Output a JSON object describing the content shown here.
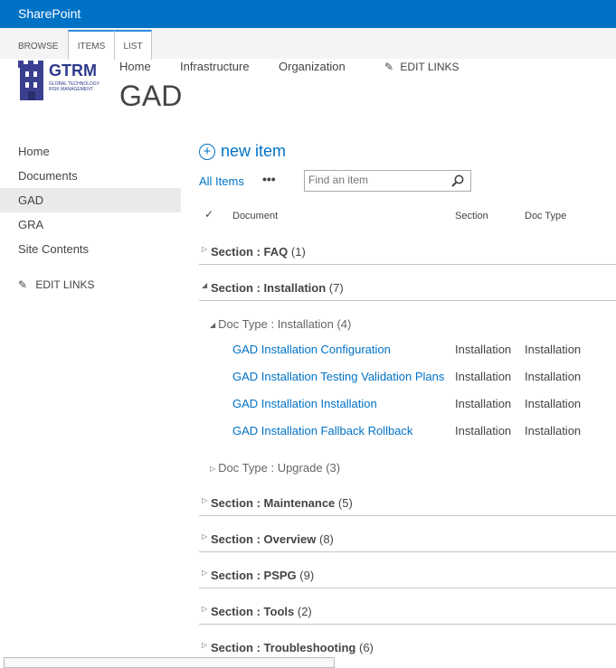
{
  "suite_bar": {
    "title": "SharePoint"
  },
  "ribbon": {
    "tabs": [
      "BROWSE",
      "ITEMS",
      "LIST"
    ]
  },
  "site": {
    "logo_text": "GTRM",
    "logo_tagline": "GLOBAL TECHNOLOGY RISK MANAGEMENT",
    "page_title": "GAD"
  },
  "top_nav": {
    "items": [
      "Home",
      "Infrastructure",
      "Organization"
    ],
    "edit_links": "EDIT LINKS"
  },
  "left_nav": {
    "items": [
      "Home",
      "Documents",
      "GAD",
      "GRA",
      "Site Contents"
    ],
    "selected": "GAD",
    "edit_links": "EDIT LINKS"
  },
  "toolbar": {
    "new_item": "new item",
    "view": "All Items",
    "more": "•••",
    "search_placeholder": "Find an item"
  },
  "list": {
    "columns": [
      "Document",
      "Section",
      "Doc Type"
    ],
    "groups": [
      {
        "label": "Section",
        "value": "FAQ",
        "count": "(1)",
        "expanded": false
      },
      {
        "label": "Section",
        "value": "Installation",
        "count": "(7)",
        "expanded": true,
        "subgroups": [
          {
            "label": "Doc Type",
            "value": "Installation",
            "count": "(4)",
            "expanded": true,
            "rows": [
              {
                "document": "GAD Installation Configuration",
                "section": "Installation",
                "doc_type": "Installation"
              },
              {
                "document": "GAD Installation Testing Validation Plans",
                "section": "Installation",
                "doc_type": "Installation"
              },
              {
                "document": "GAD Installation Installation",
                "section": "Installation",
                "doc_type": "Installation"
              },
              {
                "document": "GAD Installation Fallback Rollback",
                "section": "Installation",
                "doc_type": "Installation"
              }
            ]
          },
          {
            "label": "Doc Type",
            "value": "Upgrade",
            "count": "(3)",
            "expanded": false
          }
        ]
      },
      {
        "label": "Section",
        "value": "Maintenance",
        "count": "(5)",
        "expanded": false
      },
      {
        "label": "Section",
        "value": "Overview",
        "count": "(8)",
        "expanded": false
      },
      {
        "label": "Section",
        "value": "PSPG",
        "count": "(9)",
        "expanded": false
      },
      {
        "label": "Section",
        "value": "Tools",
        "count": "(2)",
        "expanded": false
      },
      {
        "label": "Section",
        "value": "Troubleshooting",
        "count": "(6)",
        "expanded": false
      }
    ]
  },
  "colors": {
    "suite_bar": "#0072c6",
    "link": "#0072c6",
    "selected_nav": "#eaeaea"
  }
}
